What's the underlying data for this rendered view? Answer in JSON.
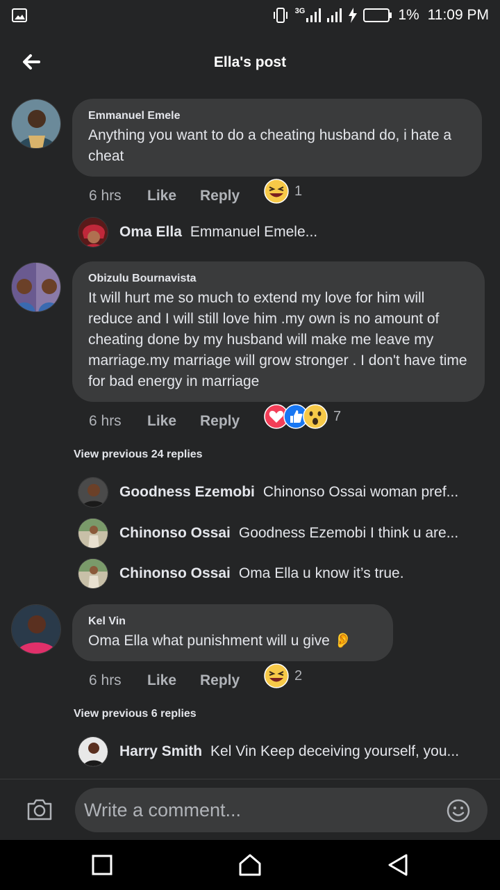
{
  "status_bar": {
    "network": "3G",
    "battery": "1%",
    "time": "11:09 PM"
  },
  "header": {
    "title": "Ella's post"
  },
  "comments": [
    {
      "author": "Emmanuel Emele",
      "text": "Anything you want to do a cheating husband do, i hate a cheat",
      "time": "6 hrs",
      "like": "Like",
      "reply": "Reply",
      "reaction_count": "1",
      "reactions": [
        "laughing-emoji"
      ]
    },
    {
      "author": "Obizulu Bournavista",
      "text": "It will hurt me so much to extend my love for him will reduce and I will still love him .my own is no amount of cheating done by my husband will make me leave my marriage.my marriage will grow stronger . I don't have time for bad energy in marriage",
      "time": "6 hrs",
      "like": "Like",
      "reply": "Reply",
      "reaction_count": "7",
      "reactions": [
        "love-reaction",
        "like-reaction",
        "wow-emoji"
      ]
    },
    {
      "author": "Kel Vin",
      "text": "Oma Ella what punishment will u give 👂",
      "time": "6 hrs",
      "like": "Like",
      "reply": "Reply",
      "reaction_count": "2",
      "reactions": [
        "laughing-emoji"
      ]
    }
  ],
  "replies": [
    {
      "author": "Oma Ella",
      "text": "Emmanuel Emele..."
    },
    {
      "author": "Goodness Ezemobi",
      "text": "Chinonso Ossai woman pref..."
    },
    {
      "author": "Chinonso Ossai",
      "text": "Goodness Ezemobi  I think u are..."
    },
    {
      "author": "Chinonso Ossai",
      "text": "Oma Ella  u know it’s true."
    },
    {
      "author": "Harry Smith",
      "text": "Kel Vin Keep deceiving yourself, you..."
    }
  ],
  "view_previous": [
    "View previous 24 replies",
    "View previous 6 replies"
  ],
  "composer": {
    "placeholder": "Write a comment..."
  },
  "colors": {
    "background": "#242526",
    "bubble": "#3a3b3c",
    "text": "#e4e6eb",
    "muted": "#b0b3b8",
    "love": "#f33e58",
    "like": "#1877f2",
    "emoji_yellow": "#f7c948"
  }
}
